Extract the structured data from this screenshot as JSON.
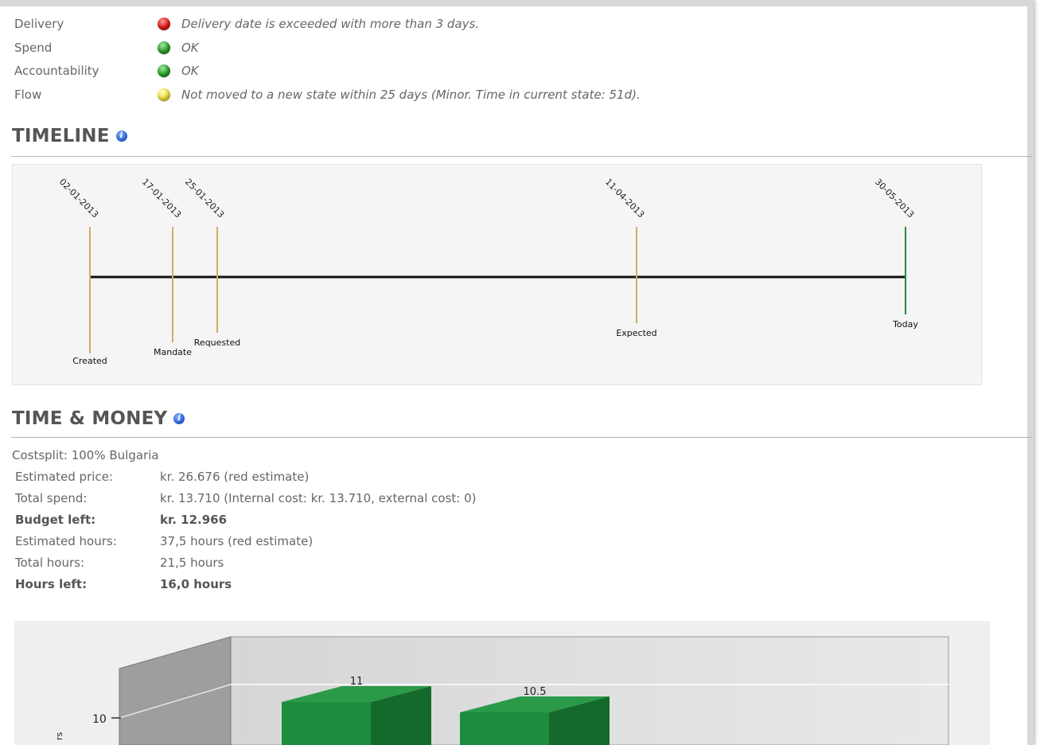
{
  "status": [
    {
      "label": "Delivery",
      "color": "red",
      "text": "Delivery date is exceeded with more than 3 days."
    },
    {
      "label": "Spend",
      "color": "green",
      "text": "OK"
    },
    {
      "label": "Accountability",
      "color": "green",
      "text": "OK"
    },
    {
      "label": "Flow",
      "color": "yellow",
      "text": "Not moved to a new state within 25 days (Minor. Time in current state: 51d)."
    }
  ],
  "timeline": {
    "title": "TIMELINE",
    "events": [
      {
        "date": "02-01-2013",
        "label": "Created"
      },
      {
        "date": "17-01-2013",
        "label": "Mandate"
      },
      {
        "date": "25-01-2013",
        "label": "Requested"
      },
      {
        "date": "11-04-2013",
        "label": "Expected"
      },
      {
        "date": "30-05-2013",
        "label": "Today"
      }
    ]
  },
  "time_money": {
    "title": "TIME & MONEY",
    "costsplit": "Costsplit: 100% Bulgaria",
    "rows": [
      {
        "label": "Estimated price:",
        "value": "kr. 26.676 (red estimate)",
        "bold": false
      },
      {
        "label": "Total spend:",
        "value": "kr. 13.710 (Internal cost: kr. 13.710, external cost: 0)",
        "bold": false
      },
      {
        "label": "Budget left:",
        "value": "kr. 12.966",
        "bold": true
      },
      {
        "label": "Estimated hours:",
        "value": "37,5 hours (red estimate)",
        "bold": false
      },
      {
        "label": "Total hours:",
        "value": "21,5 hours",
        "bold": false
      },
      {
        "label": "Hours left:",
        "value": "16,0 hours",
        "bold": true
      }
    ]
  },
  "chart_data": {
    "type": "bar",
    "categories": [
      "",
      ""
    ],
    "values": [
      11,
      10.5
    ],
    "bar_labels": [
      "11",
      "10.5"
    ],
    "y_tick": "10",
    "ylabel_fragment": "rs",
    "colors": {
      "bar_front": "#1e8c3e",
      "bar_side": "#146a2c",
      "bar_top": "#2a9a48"
    }
  }
}
